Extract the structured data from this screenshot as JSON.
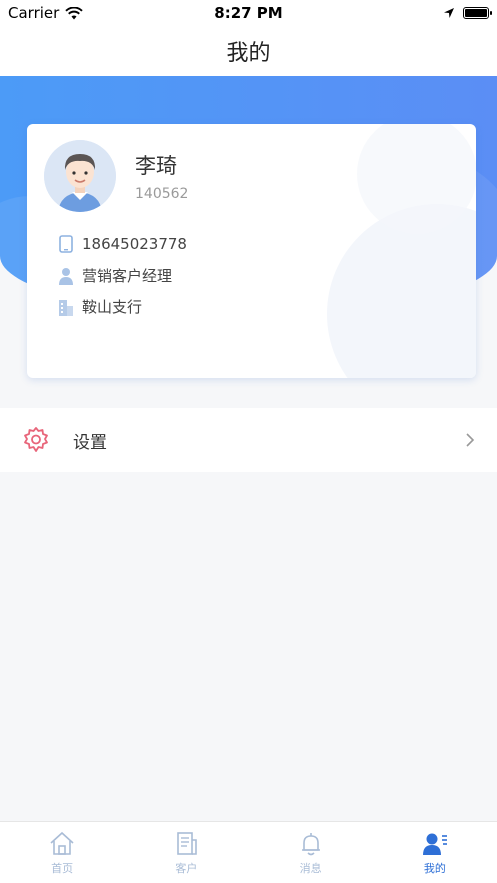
{
  "status_bar": {
    "carrier": "Carrier",
    "time": "8:27 PM"
  },
  "nav": {
    "title": "我的"
  },
  "profile": {
    "name": "李琦",
    "employee_id": "140562",
    "phone": "18645023778",
    "role": "营销客户经理",
    "branch": "鞍山支行"
  },
  "settings": {
    "label": "设置"
  },
  "tabs": [
    {
      "label": "首页",
      "icon": "home-icon",
      "active": false
    },
    {
      "label": "客户",
      "icon": "customer-icon",
      "active": false
    },
    {
      "label": "消息",
      "icon": "bell-icon",
      "active": false
    },
    {
      "label": "我的",
      "icon": "profile-icon",
      "active": true
    }
  ],
  "colors": {
    "accent": "#2e6fd6",
    "header_blue": "#4c9bf7",
    "settings_icon": "#e8657a",
    "tab_inactive": "#a9bcd6"
  }
}
